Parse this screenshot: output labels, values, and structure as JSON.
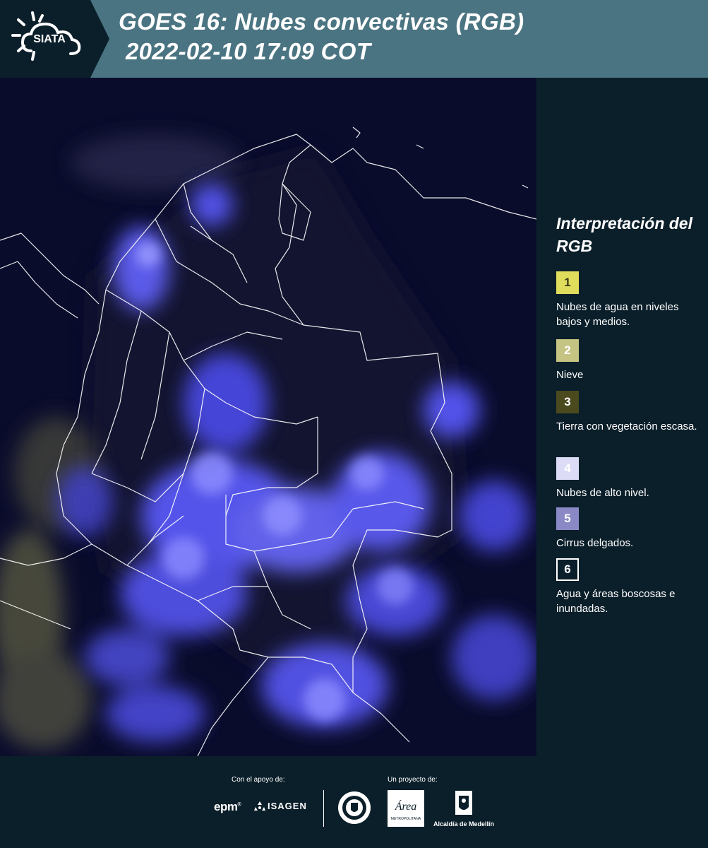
{
  "header": {
    "logo_text": "SIATA",
    "title_line1": "GOES 16: Nubes convectivas (RGB)",
    "title_line2": "2022-02-10 17:09 COT"
  },
  "legend": {
    "title": "Interpretación del RGB",
    "items": [
      {
        "number": "1",
        "label": "Nubes de agua en niveles bajos y medios.",
        "color": "#e0dc5c",
        "text_color": "#3a3a1a"
      },
      {
        "number": "2",
        "label": "Nieve",
        "color": "#c6c483",
        "text_color": "#ffffff"
      },
      {
        "number": "3",
        "label": "Tierra con vegetación escasa.",
        "color": "#4a4a1e",
        "text_color": "#ffffff"
      },
      {
        "number": "4",
        "label": "Nubes de alto nivel.",
        "color": "#dcdcf6",
        "text_color": "#ffffff"
      },
      {
        "number": "5",
        "label": "Cirrus delgados.",
        "color": "#8a89c6",
        "text_color": "#ffffff"
      },
      {
        "number": "6",
        "label": "Agua y áreas boscosas e inundadas.",
        "color": "#0b1f2a",
        "text_color": "#ffffff"
      }
    ]
  },
  "footer": {
    "support_caption": "Con el apoyo de:",
    "project_caption": "Un proyecto de:",
    "epm": "epm",
    "isagen": "ISAGEN",
    "area_text": "Área",
    "area_subtext": "METROPOLITANA",
    "alcaldia": "Alcaldía de Medellín"
  },
  "colors": {
    "header_bg": "#4a7482",
    "panel_bg": "#0b1f2a",
    "cloud_color": "#6b6bff",
    "ocean_color": "#0a0c2c"
  }
}
